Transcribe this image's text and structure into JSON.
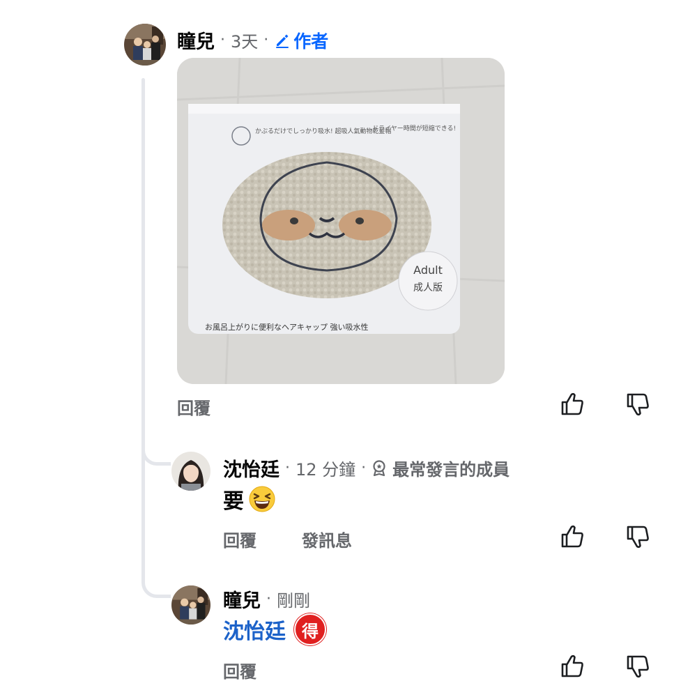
{
  "comments": [
    {
      "author": "瞳兒",
      "time": "3天",
      "badge_label": "作者",
      "badge_icon": "pencil-icon",
      "reply_label": "回覆"
    },
    {
      "author": "沈怡廷",
      "time": "12 分鐘",
      "badge_label": "最常發言的成員",
      "badge_icon": "medal-icon",
      "text": "要",
      "emoji": "grinning-squinting-face",
      "reply_label": "回覆",
      "message_label": "發訊息"
    },
    {
      "author": "瞳兒",
      "time": "剛剛",
      "mention": "沈怡廷",
      "mention_badge": "得",
      "reply_label": "回覆"
    }
  ],
  "photo": {
    "pack_text_top_left": "かぶるだけでしっかり吸水! 超吸人氣動物乾髮帽",
    "pack_text_top_right": "ドライヤー時間が短縮できる!",
    "pack_label_en": "Adult",
    "pack_label_zh": "成人版",
    "pack_text_bottom": "お風呂上がりに便利なヘアキャップ 強い吸水性"
  },
  "colors": {
    "accent_blue": "#0866ff",
    "mention_blue": "#1c62c9",
    "secondary_text": "#65676b",
    "thread_line": "#e4e6eb"
  }
}
